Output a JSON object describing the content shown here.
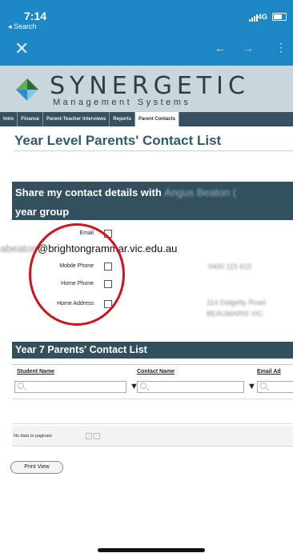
{
  "status": {
    "time": "7:14",
    "back_label": "◂ Search",
    "network": "4G"
  },
  "browser": {
    "close_glyph": "✕",
    "back_glyph": "←",
    "forward_glyph": "→",
    "more_glyph": "⋮"
  },
  "brand": {
    "title": "SYNERGETIC",
    "subtitle": "Management Systems",
    "logo_colors": [
      "#2e6b3a",
      "#5fb24b",
      "#2a8fc6",
      "#7fc6e8"
    ]
  },
  "tabs": [
    {
      "label": "Intro"
    },
    {
      "label": "Finance"
    },
    {
      "label": "Parent-Teacher Interviews"
    },
    {
      "label": "Reports"
    },
    {
      "label": "Parent Contacts",
      "active": true
    }
  ],
  "page": {
    "title": "Year Level Parents' Contact List"
  },
  "share": {
    "line1_prefix": "Share my contact details with",
    "line1_blurred": "Angus Beaton (",
    "line2": "year group"
  },
  "fields": {
    "email_label": "Email",
    "email_value_blurred": "abeaton",
    "email_value": "@brightongrammar.vic.edu.au",
    "mobile_label": "Mobile Phone",
    "mobile_value_blurred": "0400 115 615",
    "home_phone_label": "Home Phone",
    "home_address_label": "Home Address",
    "address_blurred_1": "114 Dalgetty Road",
    "address_blurred_2": "BEAUMARIS VIC"
  },
  "contact_list": {
    "title": "Year 7 Parents' Contact List",
    "columns": [
      "Student Name",
      "Contact Name",
      "Email Ad"
    ],
    "pager_text": "No data to paginate"
  },
  "print_label": "Print View",
  "colors": {
    "accent_blue": "#1e88c6",
    "section_bar": "#33505f",
    "highlight_red": "#d3121c"
  }
}
